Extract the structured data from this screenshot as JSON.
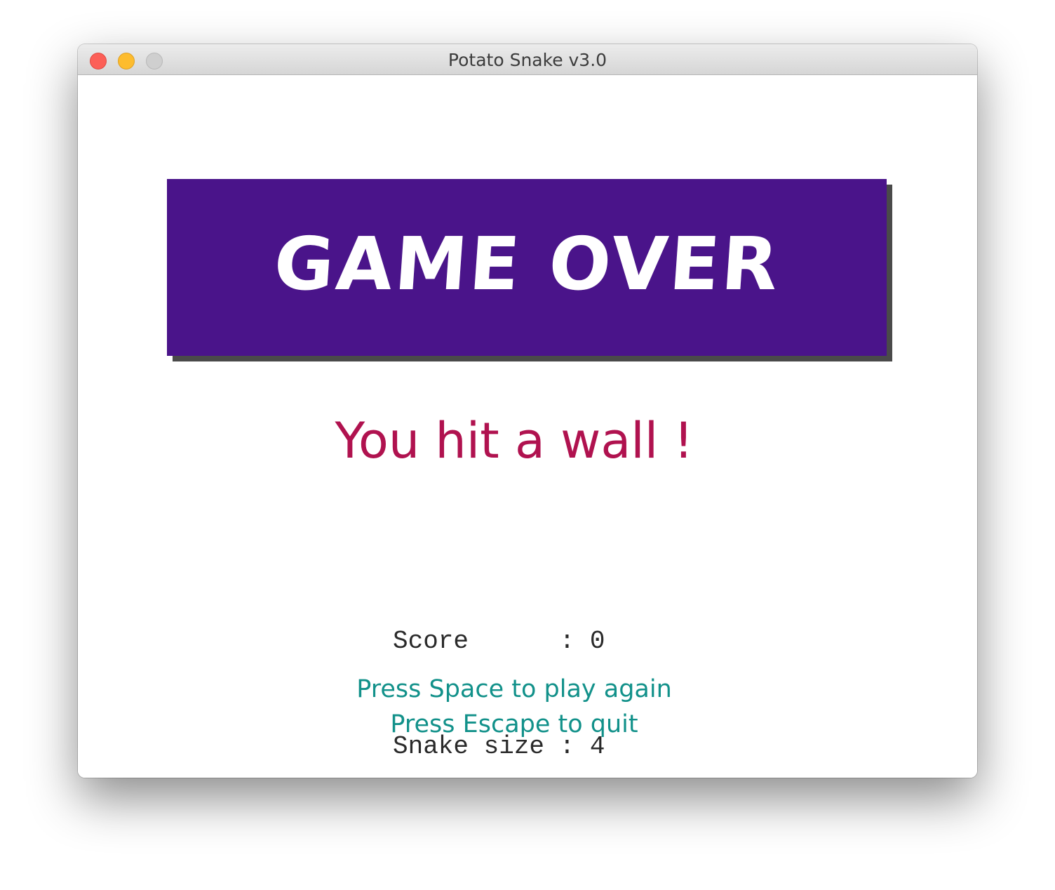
{
  "window": {
    "title": "Potato Snake v3.0"
  },
  "game_over": {
    "banner_text": "GAME OVER",
    "message": "You hit a wall !"
  },
  "stats": {
    "score_label": "Score     ",
    "score_value": "0",
    "size_label": "Snake size",
    "size_value": "4",
    "separator": " : "
  },
  "hints": {
    "play_again": "Press Space to play again",
    "quit": "Press Escape to quit"
  },
  "colors": {
    "banner": "#4a148a",
    "message": "#b0124f",
    "hints": "#12918a"
  }
}
